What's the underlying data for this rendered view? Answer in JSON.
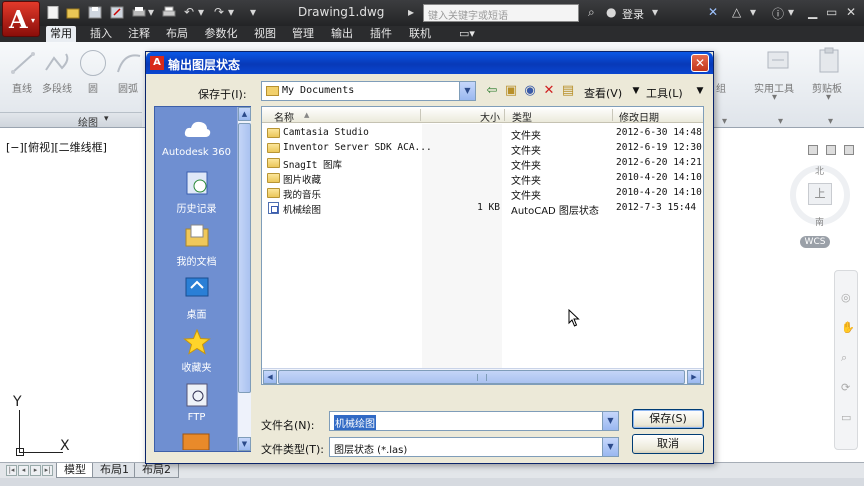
{
  "window": {
    "title": "Drawing1.dwg",
    "search_placeholder": "键入关键字或短语",
    "login": "登录"
  },
  "ribbon": {
    "tabs": [
      {
        "label": "常用",
        "active": true
      },
      {
        "label": "插入"
      },
      {
        "label": "注释"
      },
      {
        "label": "布局"
      },
      {
        "label": "参数化"
      },
      {
        "label": "视图"
      },
      {
        "label": "管理"
      },
      {
        "label": "输出"
      },
      {
        "label": "插件"
      },
      {
        "label": "联机"
      }
    ],
    "tools": [
      "直线",
      "多段线",
      "圆",
      "圆弧"
    ],
    "panel_draw": "绘图",
    "right_tools": [
      "实用工具",
      "剪贴板"
    ]
  },
  "viewport": {
    "label": "[−][俯视][二维线框]",
    "compass": {
      "north": "北",
      "south": "南",
      "center": "上"
    },
    "wcs": "WCS",
    "ucs_x": "X",
    "ucs_y": "Y"
  },
  "layout_tabs": [
    "模型",
    "布局1",
    "布局2"
  ],
  "dialog": {
    "title": "输出图层状态",
    "save_in_label": "保存于(I):",
    "save_in_value": "My Documents",
    "views_label": "查看(V)",
    "tools_label": "工具(L)",
    "places": [
      "Autodesk 360",
      "历史记录",
      "我的文档",
      "桌面",
      "收藏夹",
      "FTP"
    ],
    "columns": [
      "名称",
      "大小",
      "类型",
      "修改日期"
    ],
    "files": [
      {
        "name": "Camtasia Studio",
        "size": "",
        "type": "文件夹",
        "date": "2012-6-30 14:48",
        "icon": "folder-icon"
      },
      {
        "name": "Inventor Server SDK ACA...",
        "size": "",
        "type": "文件夹",
        "date": "2012-6-19 12:30",
        "icon": "folder-icon"
      },
      {
        "name": "SnagIt 图库",
        "size": "",
        "type": "文件夹",
        "date": "2012-6-20 14:21",
        "icon": "folder-icon"
      },
      {
        "name": "图片收藏",
        "size": "",
        "type": "文件夹",
        "date": "2010-4-20 14:10",
        "icon": "folder-icon"
      },
      {
        "name": "我的音乐",
        "size": "",
        "type": "文件夹",
        "date": "2010-4-20 14:10",
        "icon": "folder-icon"
      },
      {
        "name": "机械绘图",
        "size": "1 KB",
        "type": "AutoCAD 图层状态",
        "date": "2012-7-3 15:44",
        "icon": "layer-state-file-icon"
      }
    ],
    "filename_label": "文件名(N):",
    "filename_value": "机械绘图",
    "filetype_label": "文件类型(T):",
    "filetype_value": "图层状态 (*.las)",
    "save_button": "保存(S)",
    "cancel_button": "取消"
  },
  "colors": {
    "dialog_title": "#0a46d0",
    "places_bar": "#6f8fd1",
    "selection": "#316ac5"
  }
}
